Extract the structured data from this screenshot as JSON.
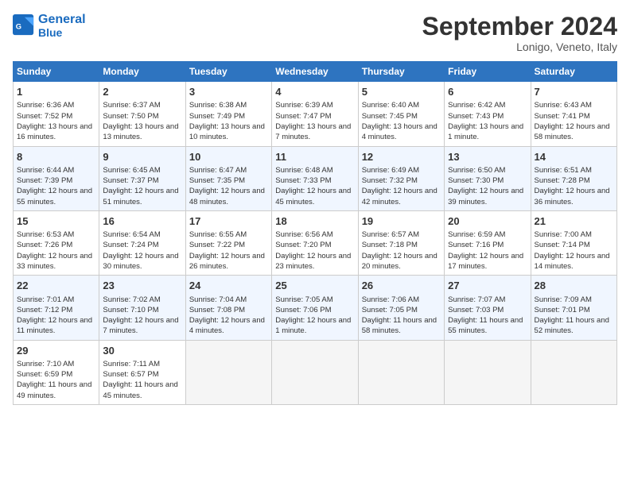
{
  "header": {
    "logo_line1": "General",
    "logo_line2": "Blue",
    "month": "September 2024",
    "location": "Lonigo, Veneto, Italy"
  },
  "days_of_week": [
    "Sunday",
    "Monday",
    "Tuesday",
    "Wednesday",
    "Thursday",
    "Friday",
    "Saturday"
  ],
  "weeks": [
    [
      {
        "day": "1",
        "sunrise": "Sunrise: 6:36 AM",
        "sunset": "Sunset: 7:52 PM",
        "daylight": "Daylight: 13 hours and 16 minutes."
      },
      {
        "day": "2",
        "sunrise": "Sunrise: 6:37 AM",
        "sunset": "Sunset: 7:50 PM",
        "daylight": "Daylight: 13 hours and 13 minutes."
      },
      {
        "day": "3",
        "sunrise": "Sunrise: 6:38 AM",
        "sunset": "Sunset: 7:49 PM",
        "daylight": "Daylight: 13 hours and 10 minutes."
      },
      {
        "day": "4",
        "sunrise": "Sunrise: 6:39 AM",
        "sunset": "Sunset: 7:47 PM",
        "daylight": "Daylight: 13 hours and 7 minutes."
      },
      {
        "day": "5",
        "sunrise": "Sunrise: 6:40 AM",
        "sunset": "Sunset: 7:45 PM",
        "daylight": "Daylight: 13 hours and 4 minutes."
      },
      {
        "day": "6",
        "sunrise": "Sunrise: 6:42 AM",
        "sunset": "Sunset: 7:43 PM",
        "daylight": "Daylight: 13 hours and 1 minute."
      },
      {
        "day": "7",
        "sunrise": "Sunrise: 6:43 AM",
        "sunset": "Sunset: 7:41 PM",
        "daylight": "Daylight: 12 hours and 58 minutes."
      }
    ],
    [
      {
        "day": "8",
        "sunrise": "Sunrise: 6:44 AM",
        "sunset": "Sunset: 7:39 PM",
        "daylight": "Daylight: 12 hours and 55 minutes."
      },
      {
        "day": "9",
        "sunrise": "Sunrise: 6:45 AM",
        "sunset": "Sunset: 7:37 PM",
        "daylight": "Daylight: 12 hours and 51 minutes."
      },
      {
        "day": "10",
        "sunrise": "Sunrise: 6:47 AM",
        "sunset": "Sunset: 7:35 PM",
        "daylight": "Daylight: 12 hours and 48 minutes."
      },
      {
        "day": "11",
        "sunrise": "Sunrise: 6:48 AM",
        "sunset": "Sunset: 7:33 PM",
        "daylight": "Daylight: 12 hours and 45 minutes."
      },
      {
        "day": "12",
        "sunrise": "Sunrise: 6:49 AM",
        "sunset": "Sunset: 7:32 PM",
        "daylight": "Daylight: 12 hours and 42 minutes."
      },
      {
        "day": "13",
        "sunrise": "Sunrise: 6:50 AM",
        "sunset": "Sunset: 7:30 PM",
        "daylight": "Daylight: 12 hours and 39 minutes."
      },
      {
        "day": "14",
        "sunrise": "Sunrise: 6:51 AM",
        "sunset": "Sunset: 7:28 PM",
        "daylight": "Daylight: 12 hours and 36 minutes."
      }
    ],
    [
      {
        "day": "15",
        "sunrise": "Sunrise: 6:53 AM",
        "sunset": "Sunset: 7:26 PM",
        "daylight": "Daylight: 12 hours and 33 minutes."
      },
      {
        "day": "16",
        "sunrise": "Sunrise: 6:54 AM",
        "sunset": "Sunset: 7:24 PM",
        "daylight": "Daylight: 12 hours and 30 minutes."
      },
      {
        "day": "17",
        "sunrise": "Sunrise: 6:55 AM",
        "sunset": "Sunset: 7:22 PM",
        "daylight": "Daylight: 12 hours and 26 minutes."
      },
      {
        "day": "18",
        "sunrise": "Sunrise: 6:56 AM",
        "sunset": "Sunset: 7:20 PM",
        "daylight": "Daylight: 12 hours and 23 minutes."
      },
      {
        "day": "19",
        "sunrise": "Sunrise: 6:57 AM",
        "sunset": "Sunset: 7:18 PM",
        "daylight": "Daylight: 12 hours and 20 minutes."
      },
      {
        "day": "20",
        "sunrise": "Sunrise: 6:59 AM",
        "sunset": "Sunset: 7:16 PM",
        "daylight": "Daylight: 12 hours and 17 minutes."
      },
      {
        "day": "21",
        "sunrise": "Sunrise: 7:00 AM",
        "sunset": "Sunset: 7:14 PM",
        "daylight": "Daylight: 12 hours and 14 minutes."
      }
    ],
    [
      {
        "day": "22",
        "sunrise": "Sunrise: 7:01 AM",
        "sunset": "Sunset: 7:12 PM",
        "daylight": "Daylight: 12 hours and 11 minutes."
      },
      {
        "day": "23",
        "sunrise": "Sunrise: 7:02 AM",
        "sunset": "Sunset: 7:10 PM",
        "daylight": "Daylight: 12 hours and 7 minutes."
      },
      {
        "day": "24",
        "sunrise": "Sunrise: 7:04 AM",
        "sunset": "Sunset: 7:08 PM",
        "daylight": "Daylight: 12 hours and 4 minutes."
      },
      {
        "day": "25",
        "sunrise": "Sunrise: 7:05 AM",
        "sunset": "Sunset: 7:06 PM",
        "daylight": "Daylight: 12 hours and 1 minute."
      },
      {
        "day": "26",
        "sunrise": "Sunrise: 7:06 AM",
        "sunset": "Sunset: 7:05 PM",
        "daylight": "Daylight: 11 hours and 58 minutes."
      },
      {
        "day": "27",
        "sunrise": "Sunrise: 7:07 AM",
        "sunset": "Sunset: 7:03 PM",
        "daylight": "Daylight: 11 hours and 55 minutes."
      },
      {
        "day": "28",
        "sunrise": "Sunrise: 7:09 AM",
        "sunset": "Sunset: 7:01 PM",
        "daylight": "Daylight: 11 hours and 52 minutes."
      }
    ],
    [
      {
        "day": "29",
        "sunrise": "Sunrise: 7:10 AM",
        "sunset": "Sunset: 6:59 PM",
        "daylight": "Daylight: 11 hours and 49 minutes."
      },
      {
        "day": "30",
        "sunrise": "Sunrise: 7:11 AM",
        "sunset": "Sunset: 6:57 PM",
        "daylight": "Daylight: 11 hours and 45 minutes."
      },
      null,
      null,
      null,
      null,
      null
    ]
  ]
}
